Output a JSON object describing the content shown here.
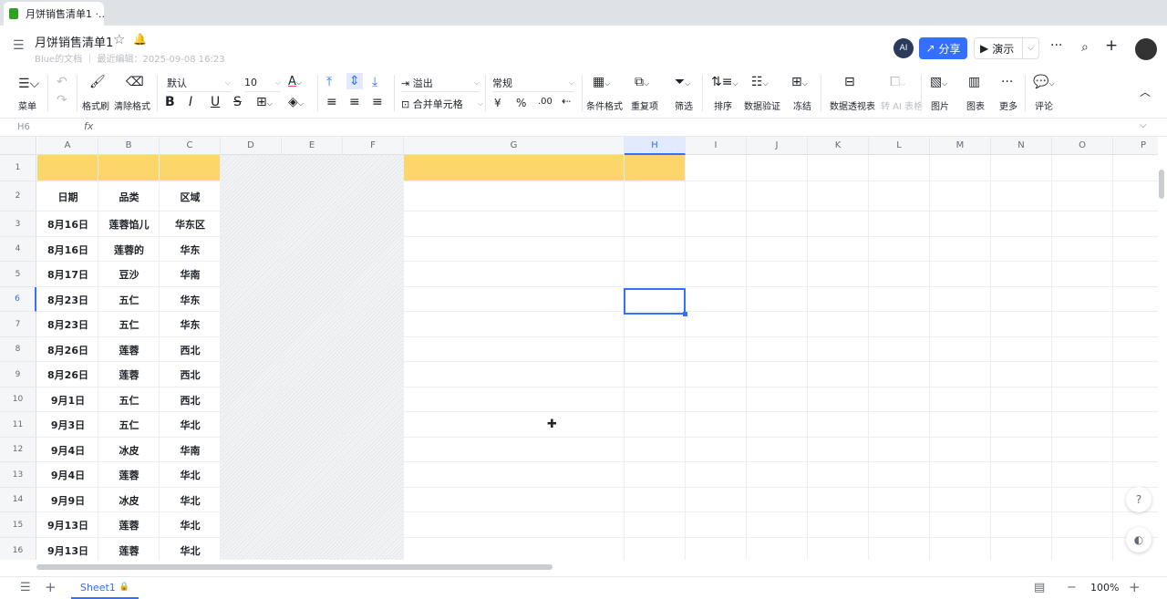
{
  "tab": {
    "title": "月饼销售清单1 ·..."
  },
  "header": {
    "doc_title": "月饼销售清单1",
    "meta": "Blue的文档 ｜ 最近编辑：2025-09-08 16:23",
    "share": "分享",
    "present": "演示",
    "ai_avatar": "AI"
  },
  "toolbar": {
    "menu": "菜单",
    "format_painter": "格式刷",
    "clear_format": "清除格式",
    "font": "默认",
    "size": "10",
    "overflow": "溢出",
    "merge": "合并单元格",
    "number_format": "常规",
    "conditional": "条件格式",
    "duplicate": "重复项",
    "filter": "筛选",
    "sort": "排序",
    "validation": "数据验证",
    "freeze": "冻结",
    "pivot": "数据透视表",
    "to_ai": "转 AI 表格",
    "image": "图片",
    "chart": "图表",
    "more": "更多",
    "comment": "评论",
    "yen": "¥",
    "percent": "%",
    "decimal": ".00"
  },
  "formula_bar": {
    "cell_ref": "H6",
    "fx": "fx"
  },
  "columns": [
    "A",
    "B",
    "C",
    "D",
    "E",
    "F",
    "G",
    "H",
    "I",
    "J",
    "K",
    "L",
    "M",
    "N",
    "O",
    "P"
  ],
  "rows": [
    "1",
    "2",
    "3",
    "4",
    "5",
    "6",
    "7",
    "8",
    "9",
    "10",
    "11",
    "12",
    "13",
    "14",
    "15",
    "16"
  ],
  "table": {
    "headers": [
      "日期",
      "品类",
      "区域"
    ],
    "rows": [
      [
        "8月16日",
        "莲蓉馅儿",
        "华东区"
      ],
      [
        "8月16日",
        "莲蓉的",
        "华东"
      ],
      [
        "8月17日",
        "豆沙",
        "华南"
      ],
      [
        "8月23日",
        "五仁",
        "华东"
      ],
      [
        "8月23日",
        "五仁",
        "华东"
      ],
      [
        "8月26日",
        "莲蓉",
        "西北"
      ],
      [
        "8月26日",
        "莲蓉",
        "西北"
      ],
      [
        "9月1日",
        "五仁",
        "西北"
      ],
      [
        "9月3日",
        "五仁",
        "华北"
      ],
      [
        "9月4日",
        "冰皮",
        "华南"
      ],
      [
        "9月4日",
        "莲蓉",
        "华北"
      ],
      [
        "9月9日",
        "冰皮",
        "华北"
      ],
      [
        "9月13日",
        "莲蓉",
        "华北"
      ],
      [
        "9月13日",
        "莲蓉",
        "华北"
      ]
    ]
  },
  "colors": {
    "accent": "#3370ff",
    "header_fill": "#fcd66b"
  },
  "bottom": {
    "sheet": "Sheet1",
    "zoom": "100%"
  }
}
